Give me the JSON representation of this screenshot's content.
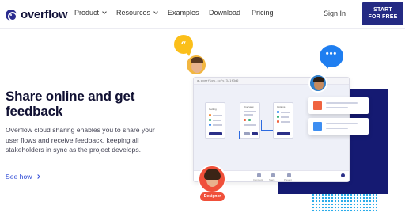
{
  "brand": {
    "name": "overflow"
  },
  "nav": {
    "items": [
      {
        "label": "Product",
        "has_dropdown": true
      },
      {
        "label": "Resources",
        "has_dropdown": true
      },
      {
        "label": "Examples",
        "has_dropdown": false
      },
      {
        "label": "Download",
        "has_dropdown": false
      },
      {
        "label": "Pricing",
        "has_dropdown": false
      }
    ],
    "signin_label": "Sign In",
    "cta_line1": "START",
    "cta_line2": "FOR FREE"
  },
  "hero": {
    "title": "Share online and get feedback",
    "description": "Overflow cloud sharing enables you to share your user flows and receive feedback, keeping all stakeholders in sync as the project develops.",
    "link_label": "See how"
  },
  "illustration": {
    "browser_url": "a.overflow.io/y/3/1f3d2",
    "screen_titles": [
      "Getting",
      "Overview",
      "Options"
    ],
    "footer_labels": [
      "Comment",
      "Share",
      "Present"
    ],
    "designer_label": "Designer",
    "bubble_quote": "“",
    "bubble_dots": "•••",
    "colors": {
      "brand_navy": "#242a83",
      "accent_blue": "#2f4bd6",
      "card_orange": "#f0633f",
      "card_blue": "#3d8ef2",
      "bubble_yellow": "#fbbf1a",
      "bubble_blue": "#1f7ef0",
      "designer_red": "#f0503a"
    }
  }
}
